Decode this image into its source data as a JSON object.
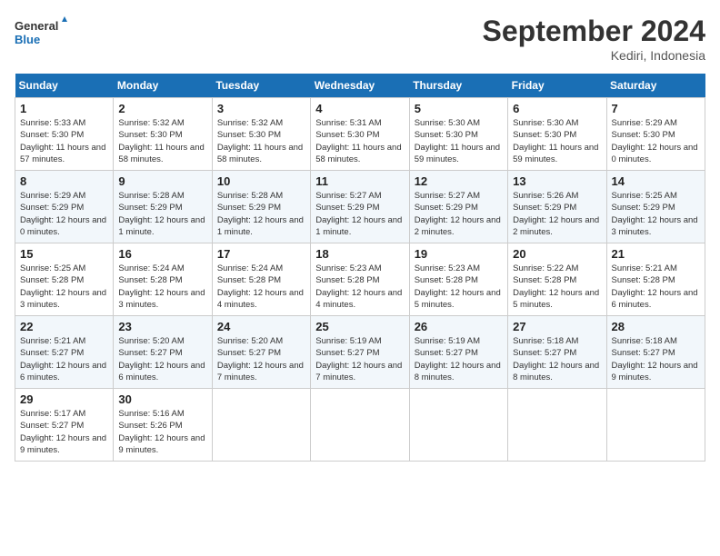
{
  "header": {
    "logo_line1": "General",
    "logo_line2": "Blue",
    "month": "September 2024",
    "location": "Kediri, Indonesia"
  },
  "weekdays": [
    "Sunday",
    "Monday",
    "Tuesday",
    "Wednesday",
    "Thursday",
    "Friday",
    "Saturday"
  ],
  "weeks": [
    [
      {
        "day": "1",
        "sunrise": "5:33 AM",
        "sunset": "5:30 PM",
        "daylight": "11 hours and 57 minutes."
      },
      {
        "day": "2",
        "sunrise": "5:32 AM",
        "sunset": "5:30 PM",
        "daylight": "11 hours and 58 minutes."
      },
      {
        "day": "3",
        "sunrise": "5:32 AM",
        "sunset": "5:30 PM",
        "daylight": "11 hours and 58 minutes."
      },
      {
        "day": "4",
        "sunrise": "5:31 AM",
        "sunset": "5:30 PM",
        "daylight": "11 hours and 58 minutes."
      },
      {
        "day": "5",
        "sunrise": "5:30 AM",
        "sunset": "5:30 PM",
        "daylight": "11 hours and 59 minutes."
      },
      {
        "day": "6",
        "sunrise": "5:30 AM",
        "sunset": "5:30 PM",
        "daylight": "11 hours and 59 minutes."
      },
      {
        "day": "7",
        "sunrise": "5:29 AM",
        "sunset": "5:30 PM",
        "daylight": "12 hours and 0 minutes."
      }
    ],
    [
      {
        "day": "8",
        "sunrise": "5:29 AM",
        "sunset": "5:29 PM",
        "daylight": "12 hours and 0 minutes."
      },
      {
        "day": "9",
        "sunrise": "5:28 AM",
        "sunset": "5:29 PM",
        "daylight": "12 hours and 1 minute."
      },
      {
        "day": "10",
        "sunrise": "5:28 AM",
        "sunset": "5:29 PM",
        "daylight": "12 hours and 1 minute."
      },
      {
        "day": "11",
        "sunrise": "5:27 AM",
        "sunset": "5:29 PM",
        "daylight": "12 hours and 1 minute."
      },
      {
        "day": "12",
        "sunrise": "5:27 AM",
        "sunset": "5:29 PM",
        "daylight": "12 hours and 2 minutes."
      },
      {
        "day": "13",
        "sunrise": "5:26 AM",
        "sunset": "5:29 PM",
        "daylight": "12 hours and 2 minutes."
      },
      {
        "day": "14",
        "sunrise": "5:25 AM",
        "sunset": "5:29 PM",
        "daylight": "12 hours and 3 minutes."
      }
    ],
    [
      {
        "day": "15",
        "sunrise": "5:25 AM",
        "sunset": "5:28 PM",
        "daylight": "12 hours and 3 minutes."
      },
      {
        "day": "16",
        "sunrise": "5:24 AM",
        "sunset": "5:28 PM",
        "daylight": "12 hours and 3 minutes."
      },
      {
        "day": "17",
        "sunrise": "5:24 AM",
        "sunset": "5:28 PM",
        "daylight": "12 hours and 4 minutes."
      },
      {
        "day": "18",
        "sunrise": "5:23 AM",
        "sunset": "5:28 PM",
        "daylight": "12 hours and 4 minutes."
      },
      {
        "day": "19",
        "sunrise": "5:23 AM",
        "sunset": "5:28 PM",
        "daylight": "12 hours and 5 minutes."
      },
      {
        "day": "20",
        "sunrise": "5:22 AM",
        "sunset": "5:28 PM",
        "daylight": "12 hours and 5 minutes."
      },
      {
        "day": "21",
        "sunrise": "5:21 AM",
        "sunset": "5:28 PM",
        "daylight": "12 hours and 6 minutes."
      }
    ],
    [
      {
        "day": "22",
        "sunrise": "5:21 AM",
        "sunset": "5:27 PM",
        "daylight": "12 hours and 6 minutes."
      },
      {
        "day": "23",
        "sunrise": "5:20 AM",
        "sunset": "5:27 PM",
        "daylight": "12 hours and 6 minutes."
      },
      {
        "day": "24",
        "sunrise": "5:20 AM",
        "sunset": "5:27 PM",
        "daylight": "12 hours and 7 minutes."
      },
      {
        "day": "25",
        "sunrise": "5:19 AM",
        "sunset": "5:27 PM",
        "daylight": "12 hours and 7 minutes."
      },
      {
        "day": "26",
        "sunrise": "5:19 AM",
        "sunset": "5:27 PM",
        "daylight": "12 hours and 8 minutes."
      },
      {
        "day": "27",
        "sunrise": "5:18 AM",
        "sunset": "5:27 PM",
        "daylight": "12 hours and 8 minutes."
      },
      {
        "day": "28",
        "sunrise": "5:18 AM",
        "sunset": "5:27 PM",
        "daylight": "12 hours and 9 minutes."
      }
    ],
    [
      {
        "day": "29",
        "sunrise": "5:17 AM",
        "sunset": "5:27 PM",
        "daylight": "12 hours and 9 minutes."
      },
      {
        "day": "30",
        "sunrise": "5:16 AM",
        "sunset": "5:26 PM",
        "daylight": "12 hours and 9 minutes."
      },
      null,
      null,
      null,
      null,
      null
    ]
  ]
}
